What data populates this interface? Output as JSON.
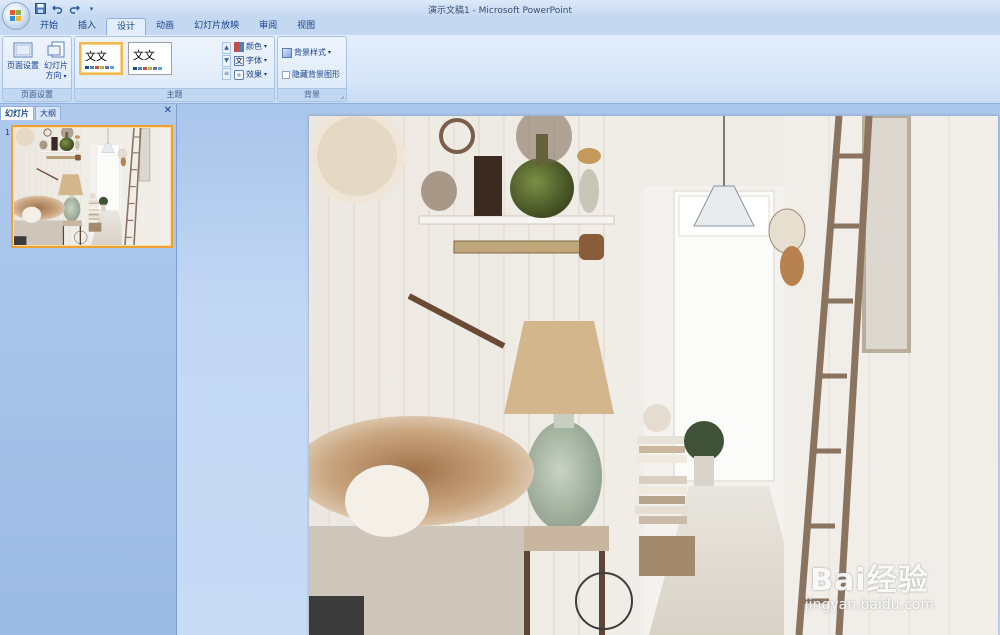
{
  "window": {
    "title": "演示文稿1 - Microsoft PowerPoint"
  },
  "quick_access": [
    "save-icon",
    "undo-icon",
    "redo-icon",
    "customize-arrow-icon"
  ],
  "tabs": [
    {
      "label": "开始",
      "active": false
    },
    {
      "label": "插入",
      "active": false
    },
    {
      "label": "设计",
      "active": true
    },
    {
      "label": "动画",
      "active": false
    },
    {
      "label": "幻灯片放映",
      "active": false
    },
    {
      "label": "审阅",
      "active": false
    },
    {
      "label": "视图",
      "active": false
    }
  ],
  "ribbon": {
    "page_setup": {
      "group_label": "页面设置",
      "page_setup_label": "页面设置",
      "orientation_label_1": "幻灯片",
      "orientation_label_2": "方向"
    },
    "themes": {
      "group_label": "主题",
      "theme_1_text": "文文",
      "theme_2_text": "文文",
      "colors_label": "颜色",
      "fonts_label": "字体",
      "effects_label": "效果"
    },
    "background": {
      "group_label": "背景",
      "styles_label": "背景样式",
      "hide_graphics_label": "隐藏背景图形",
      "hide_graphics_checked": false
    }
  },
  "left_panel": {
    "tab_slides": "幻灯片",
    "tab_outline": "大纲",
    "slide_number": "1"
  },
  "slide": {
    "watermark_brand": "Bai经验",
    "watermark_site": "jingyan.baidu.com",
    "image_description_icon": "interior-photo"
  },
  "colors": {
    "selection_border": "#f0a030",
    "ribbon_bg": "#dbe8f8",
    "canvas_bg": "#c3d8f4"
  }
}
